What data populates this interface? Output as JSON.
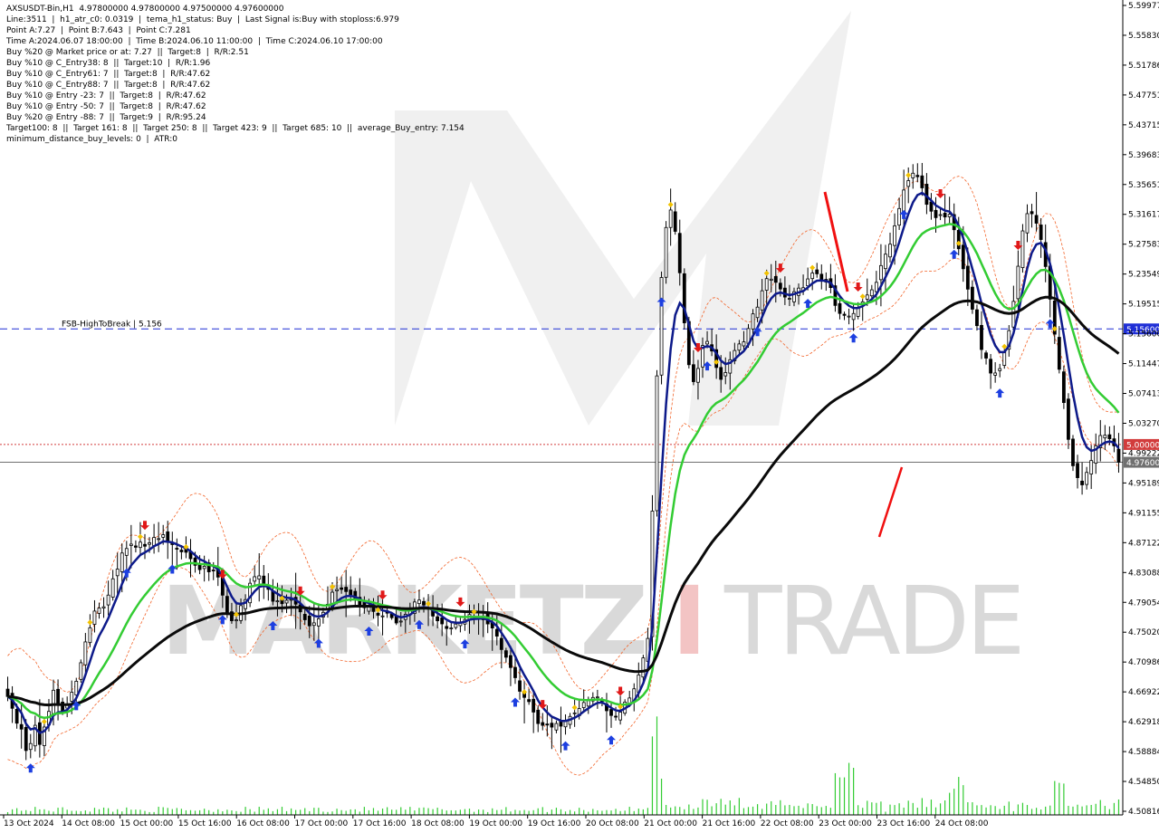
{
  "info": {
    "lines": [
      "AXSUSDT-Bin,H1  4.97800000 4.97800000 4.97500000 4.97600000",
      "Line:3511  |  h1_atr_c0: 0.0319  |  tema_h1_status: Buy  |  Last Signal is:Buy with stoploss:6.979",
      "Point A:7.27  |  Point B:7.643  |  Point C:7.281",
      "Time A:2024.06.07 18:00:00  |  Time B:2024.06.10 11:00:00  |  Time C:2024.06.10 17:00:00",
      "Buy %20 @ Market price or at: 7.27  ||  Target:8  |  R/R:2.51",
      "Buy %10 @ C_Entry38: 8  ||  Target:10  |  R/R:1.96",
      "Buy %10 @ C_Entry61: 7  ||  Target:8  |  R/R:47.62",
      "Buy %10 @ C_Entry88: 7  ||  Target:8  |  R/R:47.62",
      "Buy %10 @ Entry -23: 7  ||  Target:8  |  R/R:47.62",
      "Buy %10 @ Entry -50: 7  ||  Target:8  |  R/R:47.62",
      "Buy %20 @ Entry -88: 7  ||  Target:9  |  R/R:95.24",
      "Target100: 8  ||  Target 161: 8  ||  Target 250: 8  ||  Target 423: 9  ||  Target 685: 10  ||  average_Buy_entry: 7.154",
      "minimum_distance_buy_levels: 0  |  ATR:0"
    ]
  },
  "watermark": {
    "left": "MARKETZ",
    "mid": "I",
    "right": "TRADE"
  },
  "chart_data": {
    "type": "candlestick",
    "symbol": "AXSUSDT-Bin",
    "timeframe": "H1",
    "price_axis": {
      "ylim": [
        4.5,
        5.6
      ],
      "ticks": [
        "5.59977",
        "5.55830",
        "5.51786",
        "5.47751",
        "5.43715",
        "5.39683",
        "5.35651",
        "5.31617",
        "5.27583",
        "5.23549",
        "5.19515",
        "5.15600",
        "5.11447",
        "5.07413",
        "5.03270",
        "4.99222",
        "4.95189",
        "4.91155",
        "4.87122",
        "4.83088",
        "4.79054",
        "4.75020",
        "4.70986",
        "4.66922",
        "4.62918",
        "4.58884",
        "4.54850",
        "4.50816"
      ]
    },
    "time_axis": {
      "labels": [
        "13 Oct 2024",
        "14 Oct 08:00",
        "15 Oct 00:00",
        "15 Oct 16:00",
        "16 Oct 08:00",
        "17 Oct 00:00",
        "17 Oct 16:00",
        "18 Oct 08:00",
        "19 Oct 00:00",
        "19 Oct 16:00",
        "20 Oct 08:00",
        "21 Oct 00:00",
        "21 Oct 16:00",
        "22 Oct 08:00",
        "23 Oct 00:00",
        "23 Oct 16:00",
        "24 Oct 08:00"
      ]
    },
    "levels": [
      {
        "name": "FSB-HighToBreak",
        "label": "FSB-HighToBreak  |  5.156",
        "value": 5.156,
        "badge": "5.15600",
        "color": "#1f2fd6",
        "style": "dashed"
      },
      {
        "name": "resistance",
        "value": 5.0,
        "badge": "5.00000",
        "color": "#d23c3c",
        "style": "dotted"
      },
      {
        "name": "current-price",
        "value": 4.976,
        "badge": "4.97600",
        "color": "#707070",
        "style": "solid"
      }
    ],
    "ohlc": {
      "bar_count": 246,
      "close": [
        4.6598,
        4.6439,
        4.6238,
        4.6158,
        4.5869,
        4.5963,
        4.6209,
        4.5951,
        4.6186,
        4.6397,
        4.6683,
        4.6491,
        4.6404,
        4.6487,
        4.6656,
        4.6804,
        4.7054,
        4.7335,
        4.7526,
        4.7751,
        4.7792,
        4.7809,
        4.7967,
        4.8187,
        4.8318,
        4.8535,
        4.8596,
        4.8655,
        4.8613,
        4.8682,
        4.8627,
        4.8674,
        4.8745,
        4.8729,
        4.8782,
        4.8679,
        4.8649,
        4.8591,
        4.8551,
        4.8545,
        4.8458,
        4.8369,
        4.8311,
        4.8356,
        4.8281,
        4.8296,
        4.821,
        4.7966,
        4.7726,
        4.7621,
        4.7633,
        4.7825,
        4.7906,
        4.8127,
        4.8215,
        4.8227,
        4.8127,
        4.8045,
        4.7884,
        4.7889,
        4.7851,
        4.7897,
        4.791,
        4.7844,
        4.7741,
        4.7634,
        4.7552,
        4.7592,
        4.7648,
        4.7734,
        4.7843,
        4.8006,
        4.8042,
        4.8044,
        4.8015,
        4.7972,
        4.7909,
        4.7838,
        4.7797,
        4.7811,
        4.7746,
        4.7695,
        4.7686,
        4.7725,
        4.7662,
        4.7591,
        4.7616,
        4.7708,
        4.776,
        4.7874,
        4.79,
        4.7833,
        4.7777,
        4.7684,
        4.762,
        4.7579,
        4.7516,
        4.7523,
        4.7576,
        4.7593,
        4.7638,
        4.7704,
        4.7669,
        4.7653,
        4.768,
        4.7579,
        4.7523,
        4.7413,
        4.7232,
        4.7128,
        4.6989,
        4.6852,
        4.6669,
        4.6586,
        4.6529,
        4.6388,
        4.6233,
        4.6209,
        4.6213,
        4.6185,
        4.6234,
        4.6198,
        4.6263,
        4.6329,
        4.6377,
        4.6436,
        4.6517,
        4.6544,
        4.6585,
        4.6592,
        4.6533,
        4.6406,
        4.6342,
        4.6323,
        4.6387,
        4.6523,
        4.6578,
        4.6702,
        4.6889,
        4.7119,
        4.7382,
        4.9101,
        5.0926,
        5.2254,
        5.2929,
        5.3165,
        5.2877,
        5.2318,
        5.1642,
        5.1077,
        5.0848,
        5.1026,
        5.1336,
        5.1391,
        5.1262,
        5.1039,
        5.0879,
        5.0971,
        5.1144,
        5.1269,
        5.1357,
        5.1385,
        5.1565,
        5.1763,
        5.1854,
        5.2075,
        5.2239,
        5.2232,
        5.2189,
        5.2099,
        5.199,
        5.1972,
        5.2062,
        5.2111,
        5.2116,
        5.2235,
        5.2314,
        5.2304,
        5.222,
        5.2193,
        5.2118,
        5.1877,
        5.1769,
        5.1743,
        5.1733,
        5.1768,
        5.1844,
        5.1926,
        5.2018,
        5.2088,
        5.2189,
        5.2415,
        5.2569,
        5.2704,
        5.2952,
        5.3185,
        5.3435,
        5.3562,
        5.3662,
        5.3615,
        5.3464,
        5.3242,
        5.3149,
        5.3062,
        5.3103,
        5.3071,
        5.3108,
        5.2899,
        5.2642,
        5.2372,
        5.2097,
        5.1826,
        5.1604,
        5.1282,
        5.1166,
        5.0964,
        5.0965,
        5.1024,
        5.1248,
        5.1537,
        5.1932,
        5.2406,
        5.2883,
        5.3116,
        5.3115,
        5.2987,
        5.2767,
        5.2402,
        5.1962,
        5.1489,
        5.1015,
        5.0566,
        5.0069,
        4.9713,
        4.9552,
        4.9455,
        4.9623,
        4.9783,
        4.9983,
        5.0121,
        5.0125,
        5.0077,
        4.9982,
        4.976
      ]
    },
    "indicators": [
      {
        "name": "ma-fast-navy",
        "color": "#0d1a8a",
        "width": 2.5
      },
      {
        "name": "ma-mid-green",
        "color": "#33cc33",
        "width": 2.5
      },
      {
        "name": "ma-slow-black",
        "color": "#0a0a0a",
        "width": 3
      }
    ],
    "signals": {
      "buy_arrows": 22,
      "sell_arrows": 12,
      "diamonds": 22
    },
    "volume": {
      "color": "#33cc33"
    }
  }
}
